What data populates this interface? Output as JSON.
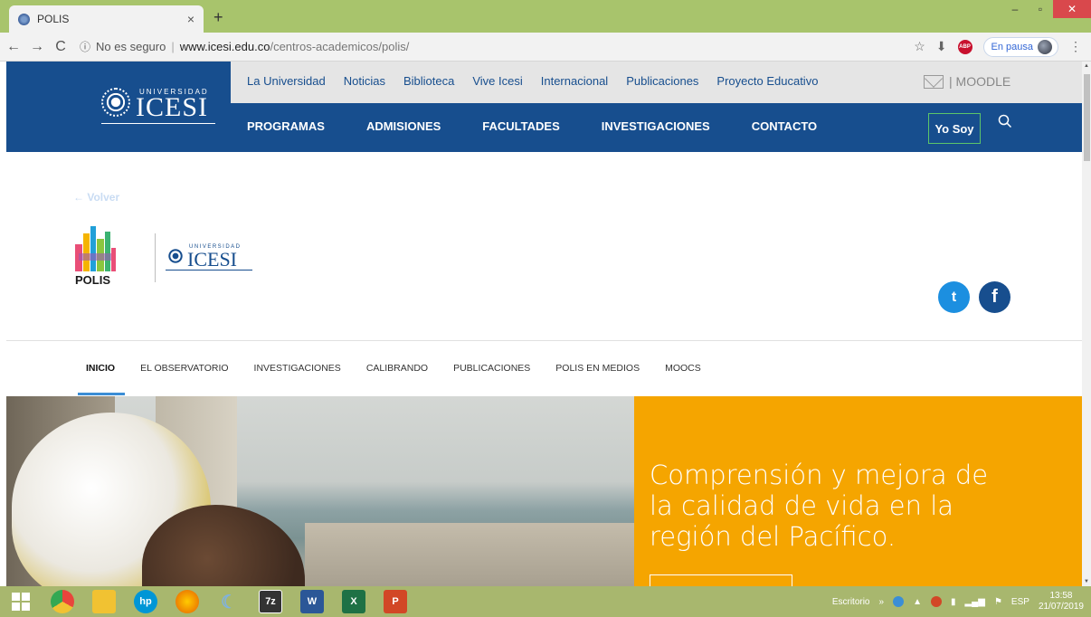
{
  "browser": {
    "tab_title": "POLIS",
    "tab_close": "×",
    "new_tab": "+",
    "window_controls": {
      "minimize": "–",
      "restore": "▫",
      "close": "✕"
    },
    "back": "←",
    "forward": "→",
    "reload": "C",
    "info_icon": "ⓘ",
    "insecure": "No es seguro",
    "separator": "|",
    "url_domain": "www.icesi.edu.co",
    "url_path": "/centros-academicos/polis/",
    "star": "☆",
    "download": "⬇",
    "abp": "ABP",
    "paused": "En pausa",
    "menu": "⋮"
  },
  "site": {
    "logo_small": "UNIVERSIDAD",
    "logo_big": "ICESI",
    "top_links": [
      "La Universidad",
      "Noticias",
      "Biblioteca",
      "Vive Icesi",
      "Internacional",
      "Publicaciones",
      "Proyecto Educativo"
    ],
    "moodle": "| MOODLE",
    "main_nav": [
      "PROGRAMAS",
      "ADMISIONES",
      "FACULTADES",
      "INVESTIGACIONES",
      "CONTACTO"
    ],
    "yo_soy": "Yo Soy",
    "volver": "← Volver",
    "polis": "POLIS",
    "social": {
      "twitter": "t",
      "facebook": "f"
    },
    "sub_nav": [
      "INICIO",
      "EL OBSERVATORIO",
      "INVESTIGACIONES",
      "CALIBRANDO",
      "PUBLICACIONES",
      "POLIS EN MEDIOS",
      "MOOCS"
    ],
    "hero_text": "Comprensión y mejora de la calidad de vida en la región del Pacífico."
  },
  "taskbar": {
    "items": [
      {
        "icon": "windows-start-icon"
      },
      {
        "icon": "chrome-icon",
        "color": "#e8453c"
      },
      {
        "icon": "file-explorer-icon",
        "color": "#f1c232"
      },
      {
        "icon": "hp-icon",
        "label": "hp",
        "color": "#0096d6"
      },
      {
        "icon": "firefox-icon",
        "color": "#e66000"
      },
      {
        "icon": "moon-app-icon",
        "color": "#7fb2e0"
      },
      {
        "icon": "7zip-icon",
        "label": "7z",
        "color": "#333333"
      },
      {
        "icon": "word-icon",
        "label": "W",
        "color": "#2b5797"
      },
      {
        "icon": "excel-icon",
        "label": "X",
        "color": "#1e7145"
      },
      {
        "icon": "powerpoint-icon",
        "label": "P",
        "color": "#d24726"
      }
    ],
    "desktop": "Escritorio",
    "chevron": "»",
    "lang": "ESP",
    "time": "13:58",
    "date": "21/07/2019"
  }
}
